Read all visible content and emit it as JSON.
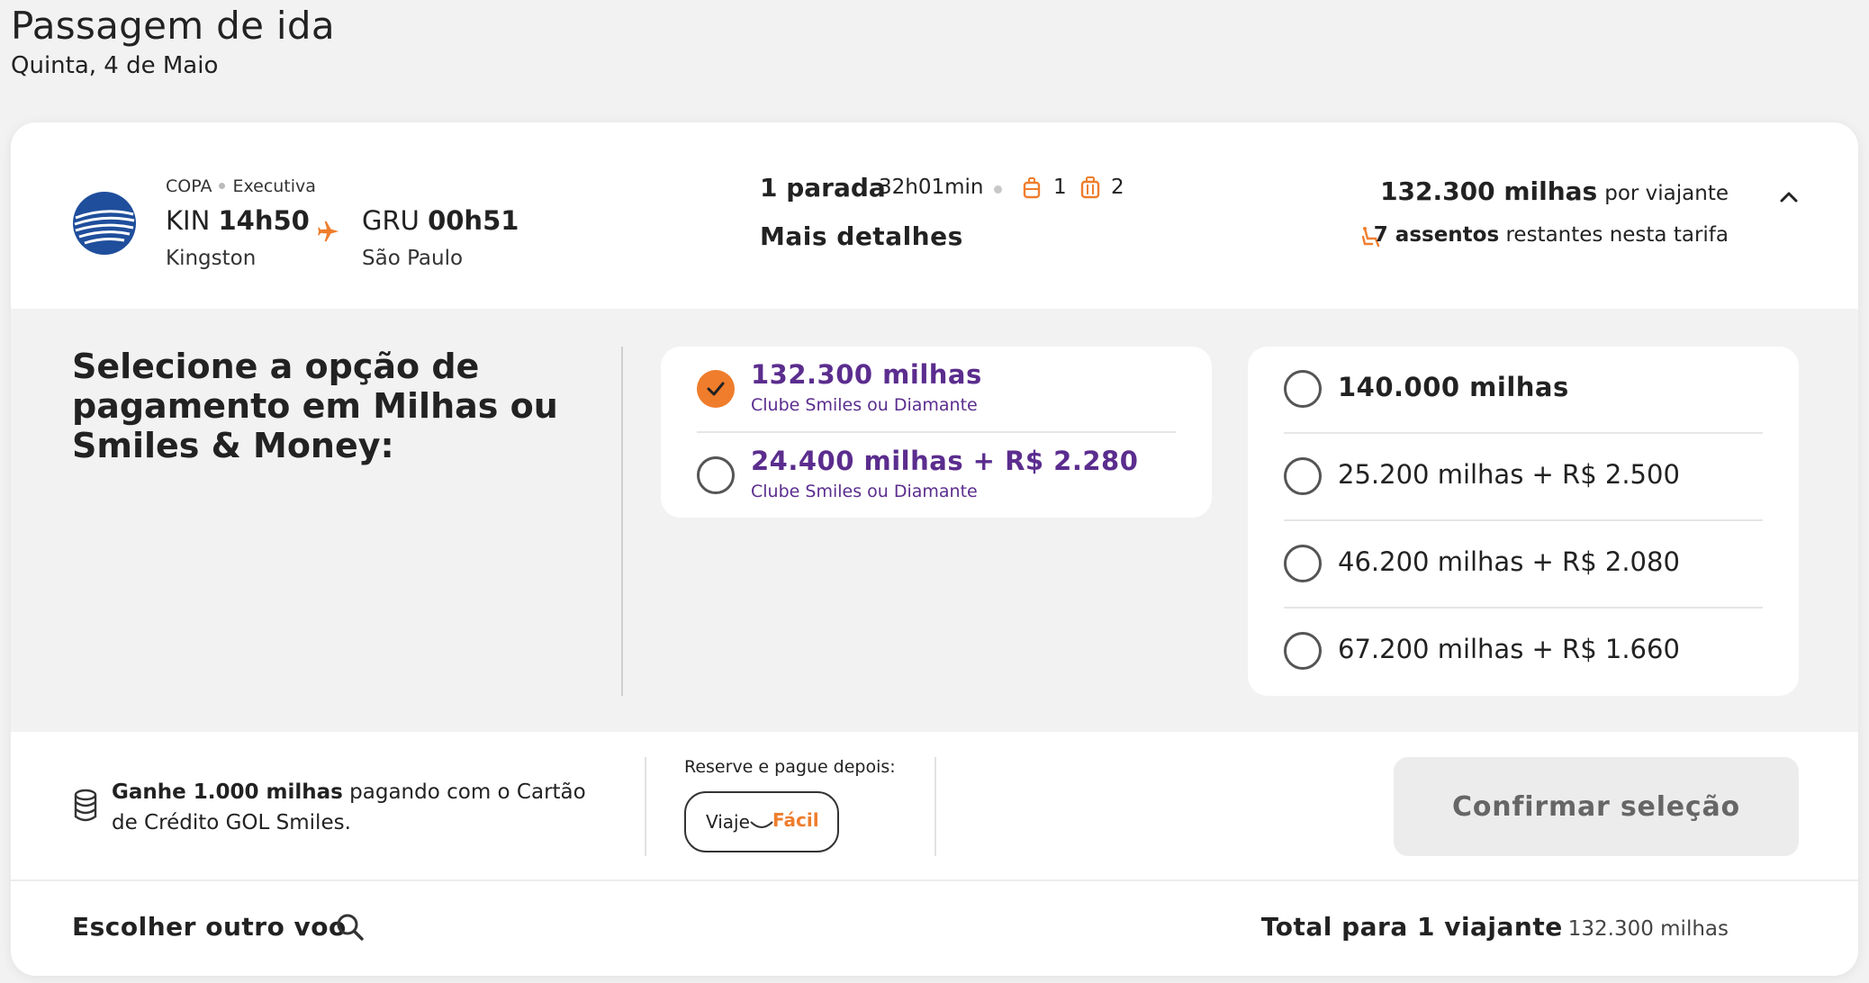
{
  "header": {
    "title": "Passagem de ida",
    "date": "Quinta, 4 de Maio"
  },
  "flight": {
    "airline": "COPA",
    "cabin": "Executiva",
    "origin": {
      "code": "KIN",
      "time": "14h50",
      "city": "Kingston"
    },
    "destination": {
      "code": "GRU",
      "time": "00h51",
      "city": "São Paulo"
    },
    "stops": "1 parada",
    "duration": "32h01min",
    "carry_on_count": "1",
    "checked_bag_count": "2",
    "more_details": "Mais detalhes",
    "price_miles": "132.300 milhas",
    "price_suffix": "por viajante",
    "seats_count": "7 assentos",
    "seats_suffix": "restantes nesta tarifa"
  },
  "payment": {
    "title": "Selecione a opção de pagamento em Milhas ou Smiles & Money:",
    "club_options": [
      {
        "label": "132.300 milhas",
        "sub": "Clube Smiles ou Diamante",
        "selected": true
      },
      {
        "label": "24.400 milhas + R$ 2.280",
        "sub": "Clube Smiles ou Diamante",
        "selected": false
      }
    ],
    "regular_options": [
      {
        "label": "140.000 milhas",
        "selected": false
      },
      {
        "label": "25.200 milhas + R$ 2.500",
        "selected": false
      },
      {
        "label": "46.200 milhas + R$ 2.080",
        "selected": false
      },
      {
        "label": "67.200 milhas + R$ 1.660",
        "selected": false
      }
    ]
  },
  "footer": {
    "earn_bold": "Ganhe 1.000 milhas",
    "earn_rest": "pagando com o Cartão de Crédito GOL Smiles.",
    "reserve_label": "Reserve e pague depois:",
    "viaje_part1": "Viaje",
    "viaje_part2": "Fácil",
    "confirm_label": "Confirmar seleção"
  },
  "bottom": {
    "other_flight": "Escolher outro voo",
    "total_label": "Total para 1 viajante",
    "total_value": "132.300 milhas"
  },
  "colors": {
    "accent_orange": "#ef7d2c",
    "smiles_purple": "#5b2d8e",
    "copa_blue": "#1f4e9c"
  },
  "icons": [
    "airline-logo",
    "plane-icon",
    "carry-on-bag-icon",
    "checked-bag-icon",
    "seat-icon",
    "chevron-up-icon",
    "check-icon",
    "coin-stack-icon",
    "search-icon"
  ]
}
